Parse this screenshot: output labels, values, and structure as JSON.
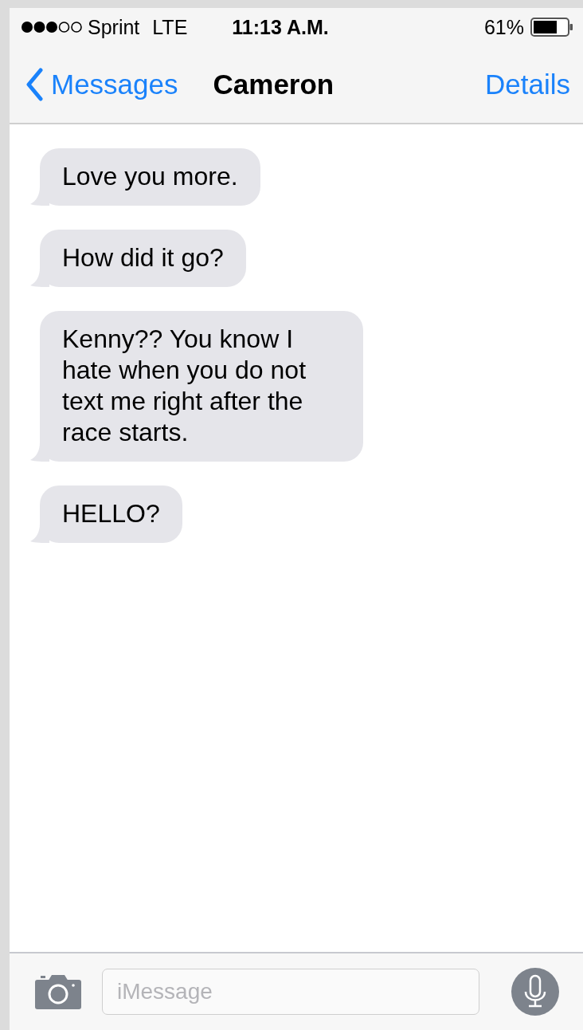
{
  "status_bar": {
    "carrier": "Sprint",
    "network": "LTE",
    "time": "11:13 A.M.",
    "battery": "61%"
  },
  "nav": {
    "back": "Messages",
    "title": "Cameron",
    "action": "Details"
  },
  "messages": [
    {
      "text": "Love you more."
    },
    {
      "text": "How did it go?"
    },
    {
      "text": "Kenny?? You know I hate when you do not text me right after the race starts."
    },
    {
      "text": "HELLO?"
    }
  ],
  "composer": {
    "placeholder": "iMessage"
  }
}
